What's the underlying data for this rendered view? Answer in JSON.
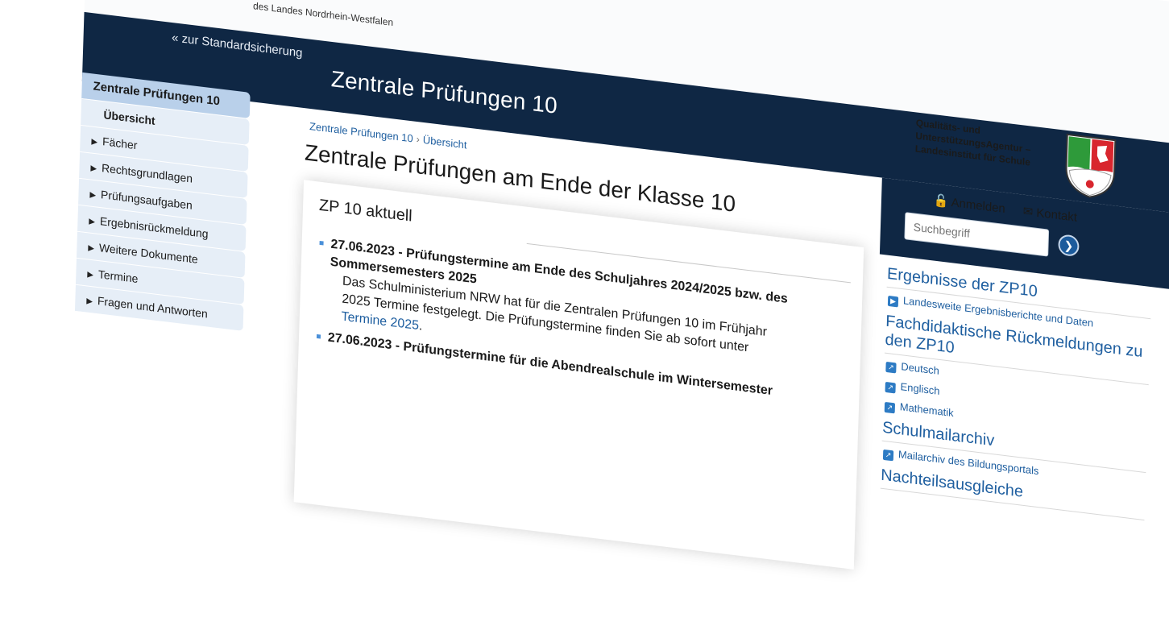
{
  "header": {
    "logo_text": "des Landes Nordrhein-Westfalen",
    "back_link": "« zur Standardsicherung",
    "site_title": "Zentrale Prüfungen 10",
    "agency_lines": [
      "Qualitäts- und",
      "UnterstützungsAgentur –",
      "Landesinstitut für Schule"
    ],
    "login_label": "Anmelden",
    "contact_label": "Kontakt",
    "search_placeholder": "Suchbegriff"
  },
  "sidebar": {
    "items": [
      {
        "label": "Zentrale Prüfungen 10"
      },
      {
        "label": "Übersicht"
      },
      {
        "label": "Fächer"
      },
      {
        "label": "Rechtsgrundlagen"
      },
      {
        "label": "Prüfungsaufgaben"
      },
      {
        "label": "Ergebnisrückmeldung"
      },
      {
        "label": "Weitere Dokumente"
      },
      {
        "label": "Termine"
      },
      {
        "label": "Fragen und Antworten"
      }
    ]
  },
  "main": {
    "breadcrumb": [
      "Zentrale Prüfungen 10",
      "Übersicht"
    ],
    "breadcrumb_sep": "›",
    "page_title": "Zentrale Prüfungen am Ende der Klasse 10",
    "section_title": "ZP 10 aktuell",
    "news": [
      {
        "headline": "27.06.2023 - Prüfungstermine am Ende des Schuljahres 2024/2025 bzw. des Sommersemesters 2025",
        "body": "Das Schulministerium NRW hat für die Zentralen Prüfungen 10 im Frühjahr 2025 Termine festgelegt. Die Prüfungstermine finden Sie ab sofort unter ",
        "link": "Termine 2025",
        "after_link": "."
      },
      {
        "headline": "27.06.2023 - Prüfungstermine für die Abendrealschule im Wintersemester"
      }
    ]
  },
  "right": {
    "sections": [
      {
        "title": "Ergebnisse der ZP10",
        "links": [
          "Landesweite Ergebnisberichte und Daten"
        ]
      },
      {
        "title": "Fachdidaktische Rückmeldungen zu den ZP10",
        "links": [
          "Deutsch",
          "Englisch",
          "Mathematik"
        ]
      },
      {
        "title": "Schulmailarchiv",
        "links": [
          "Mailarchiv des Bildungsportals"
        ]
      },
      {
        "title": "Nachteilsausgleiche",
        "links": []
      }
    ]
  },
  "colors": {
    "banner": "#0f2744",
    "link": "#1f5fa0",
    "nav_bg": "#e6eef7",
    "nav_active": "#b9d0ea"
  }
}
